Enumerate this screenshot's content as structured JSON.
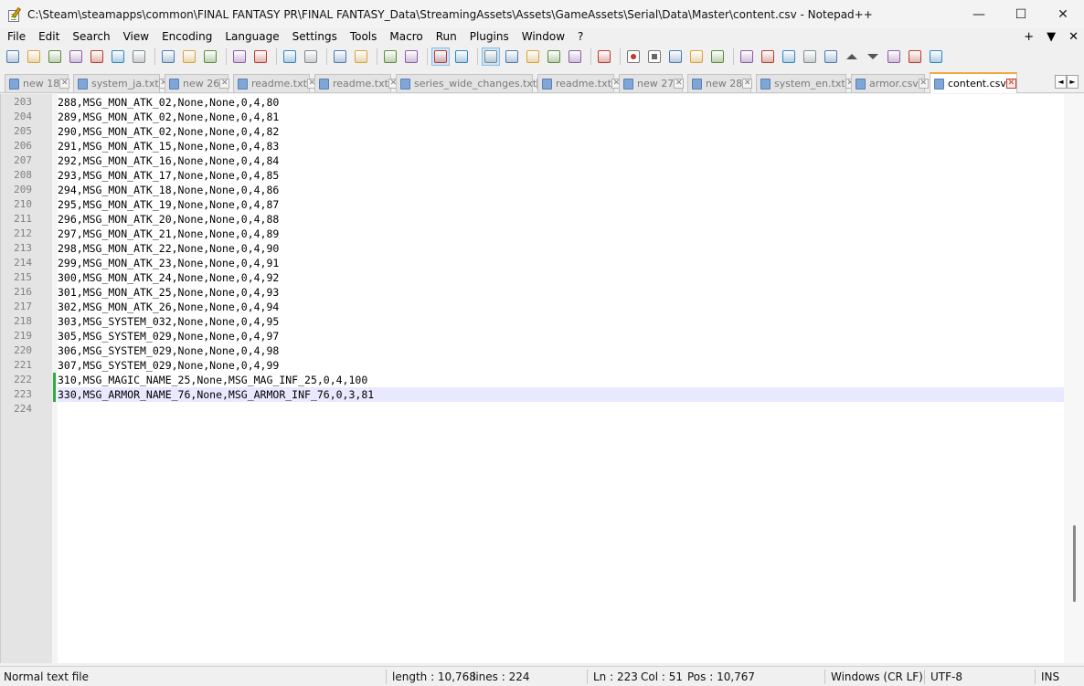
{
  "window": {
    "title": "C:\\Steam\\steamapps\\common\\FINAL FANTASY PR\\FINAL FANTASY_Data\\StreamingAssets\\Assets\\GameAssets\\Serial\\Data\\Master\\content.csv - Notepad++",
    "minimize": "—",
    "maximize": "☐",
    "close": "✕"
  },
  "menu": {
    "items": [
      "File",
      "Edit",
      "Search",
      "View",
      "Encoding",
      "Language",
      "Settings",
      "Tools",
      "Macro",
      "Run",
      "Plugins",
      "Window",
      "?"
    ],
    "right": [
      "+",
      "▼",
      "✕"
    ]
  },
  "toolbar": {
    "icons": [
      "new-file-icon",
      "open-file-icon",
      "save-icon",
      "save-all-icon",
      "close-icon",
      "close-all-icon",
      "print-icon",
      "sep",
      "cut-icon",
      "copy-icon",
      "paste-icon",
      "sep",
      "undo-icon",
      "redo-icon",
      "sep",
      "find-icon",
      "replace-icon",
      "sep",
      "zoom-in-icon",
      "zoom-out-icon",
      "sep",
      "sync-vertical-icon",
      "sync-horizontal-icon",
      "sep",
      "word-wrap-icon",
      "show-all-chars-icon",
      "sep",
      "indent-guide-icon",
      "define-language-icon",
      "document-map-icon",
      "function-list-icon",
      "folder-as-workspace-icon",
      "sep",
      "monitoring-icon",
      "sep",
      "record-macro-icon",
      "stop-macro-icon",
      "play-macro-icon",
      "run-macro-multiple-icon",
      "save-macro-icon",
      "sep",
      "show-document-list-icon",
      "show-panel-icon",
      "show-panel2-icon",
      "show-panel3-icon",
      "trim-icon",
      "up-icon",
      "down-icon",
      "sort-icon",
      "settings-icon",
      "panel-toggle-icon"
    ],
    "active": [
      "word-wrap-icon",
      "indent-guide-icon"
    ]
  },
  "tabs": [
    {
      "label": "new 18",
      "active": false
    },
    {
      "label": "system_ja.txt",
      "active": false
    },
    {
      "label": "new 26",
      "active": false
    },
    {
      "label": "readme.txt",
      "active": false
    },
    {
      "label": "readme.txt",
      "active": false
    },
    {
      "label": "series_wide_changes.txt",
      "active": false
    },
    {
      "label": "readme.txt",
      "active": false
    },
    {
      "label": "new 27",
      "active": false
    },
    {
      "label": "new 28",
      "active": false
    },
    {
      "label": "system_en.txt",
      "active": false
    },
    {
      "label": "armor.csv",
      "active": false
    },
    {
      "label": "content.csv",
      "active": true
    }
  ],
  "tab_nav": {
    "left": "◄",
    "right": "►"
  },
  "editor": {
    "current_line": 223,
    "changed_lines": [
      222,
      223
    ],
    "lines": [
      {
        "num": "203",
        "text": "288,MSG_MON_ATK_02,None,None,0,4,80"
      },
      {
        "num": "204",
        "text": "289,MSG_MON_ATK_02,None,None,0,4,81"
      },
      {
        "num": "205",
        "text": "290,MSG_MON_ATK_02,None,None,0,4,82"
      },
      {
        "num": "206",
        "text": "291,MSG_MON_ATK_15,None,None,0,4,83"
      },
      {
        "num": "207",
        "text": "292,MSG_MON_ATK_16,None,None,0,4,84"
      },
      {
        "num": "208",
        "text": "293,MSG_MON_ATK_17,None,None,0,4,85"
      },
      {
        "num": "209",
        "text": "294,MSG_MON_ATK_18,None,None,0,4,86"
      },
      {
        "num": "210",
        "text": "295,MSG_MON_ATK_19,None,None,0,4,87"
      },
      {
        "num": "211",
        "text": "296,MSG_MON_ATK_20,None,None,0,4,88"
      },
      {
        "num": "212",
        "text": "297,MSG_MON_ATK_21,None,None,0,4,89"
      },
      {
        "num": "213",
        "text": "298,MSG_MON_ATK_22,None,None,0,4,90"
      },
      {
        "num": "214",
        "text": "299,MSG_MON_ATK_23,None,None,0,4,91"
      },
      {
        "num": "215",
        "text": "300,MSG_MON_ATK_24,None,None,0,4,92"
      },
      {
        "num": "216",
        "text": "301,MSG_MON_ATK_25,None,None,0,4,93"
      },
      {
        "num": "217",
        "text": "302,MSG_MON_ATK_26,None,None,0,4,94"
      },
      {
        "num": "218",
        "text": "303,MSG_SYSTEM_032,None,None,0,4,95"
      },
      {
        "num": "219",
        "text": "305,MSG_SYSTEM_029,None,None,0,4,97"
      },
      {
        "num": "220",
        "text": "306,MSG_SYSTEM_029,None,None,0,4,98"
      },
      {
        "num": "221",
        "text": "307,MSG_SYSTEM_029,None,None,0,4,99"
      },
      {
        "num": "222",
        "text": "310,MSG_MAGIC_NAME_25,None,MSG_MAG_INF_25,0,4,100"
      },
      {
        "num": "223",
        "text": "330,MSG_ARMOR_NAME_76,None,MSG_ARMOR_INF_76,0,3,81"
      },
      {
        "num": "224",
        "text": ""
      }
    ]
  },
  "status": {
    "file_type": "Normal text file",
    "length": "length : 10,768",
    "lines": "lines : 224",
    "ln": "Ln : 223",
    "col": "Col : 51",
    "pos": "Pos : 10,767",
    "eol": "Windows (CR LF)",
    "encoding": "UTF-8",
    "mode": "INS"
  },
  "colors": {
    "current_line_bg": "#e8e8ff",
    "changed_marker": "#2eab43",
    "active_tab_accent": "#f4a940"
  }
}
